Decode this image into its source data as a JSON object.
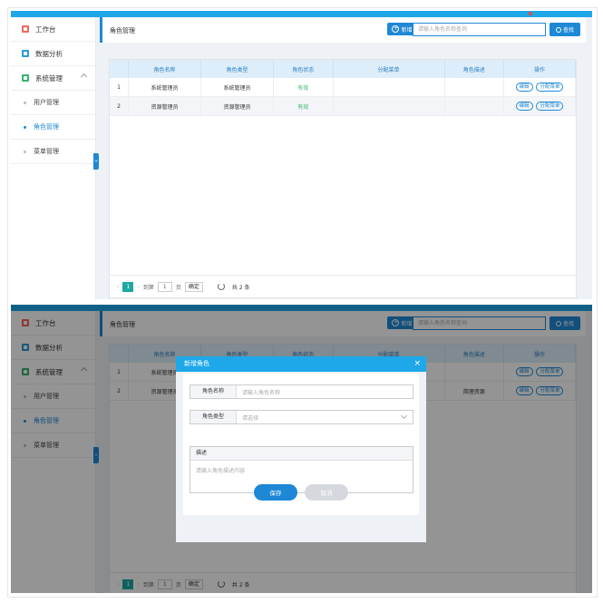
{
  "sidebar": {
    "items": [
      {
        "label": "工作台",
        "icon": "workbench-icon"
      },
      {
        "label": "数据分析",
        "icon": "analytics-icon"
      },
      {
        "label": "系统管理",
        "icon": "system-icon"
      }
    ],
    "sub_items": [
      {
        "label": "用户管理"
      },
      {
        "label": "角色管理",
        "active": true
      },
      {
        "label": "菜单管理"
      }
    ],
    "collapse_label": "«"
  },
  "header": {
    "title": "角色管理",
    "new_label": "新增",
    "search_placeholder": "请输入角色名称查询",
    "search_label": "查找"
  },
  "table": {
    "columns": [
      "",
      "角色名称",
      "角色类型",
      "角色状态",
      "分配菜单",
      "角色描述",
      "操作"
    ],
    "rows": [
      {
        "no": "1",
        "name": "系统管理员",
        "type": "系统管理员",
        "status": "有效",
        "menu": "",
        "desc": ""
      },
      {
        "no": "2",
        "name": "资源管理员",
        "type": "资源管理员",
        "status": "有效",
        "menu": "",
        "desc": ""
      }
    ],
    "row2_desc_bg": "简理资源",
    "actions": {
      "edit": "编辑",
      "assign": "分配菜单"
    }
  },
  "pager": {
    "prev": "‹",
    "current": "1",
    "next": "›",
    "goto_label": "到第",
    "page_input": "1",
    "page_unit": "页",
    "confirm": "确定",
    "total": "共 2 条"
  },
  "modal": {
    "title": "新增角色",
    "close": "×",
    "name_label": "角色名称",
    "name_placeholder": "请输入角色名称",
    "type_label": "角色类型",
    "type_placeholder": "请选择",
    "desc_label": "描述",
    "desc_placeholder": "请输入角色描述内容",
    "save": "保存",
    "cancel": "取消"
  },
  "colors": {
    "accent": "#1e88d6",
    "topbar": "#1ea8e9",
    "status": "#3bb26c"
  }
}
